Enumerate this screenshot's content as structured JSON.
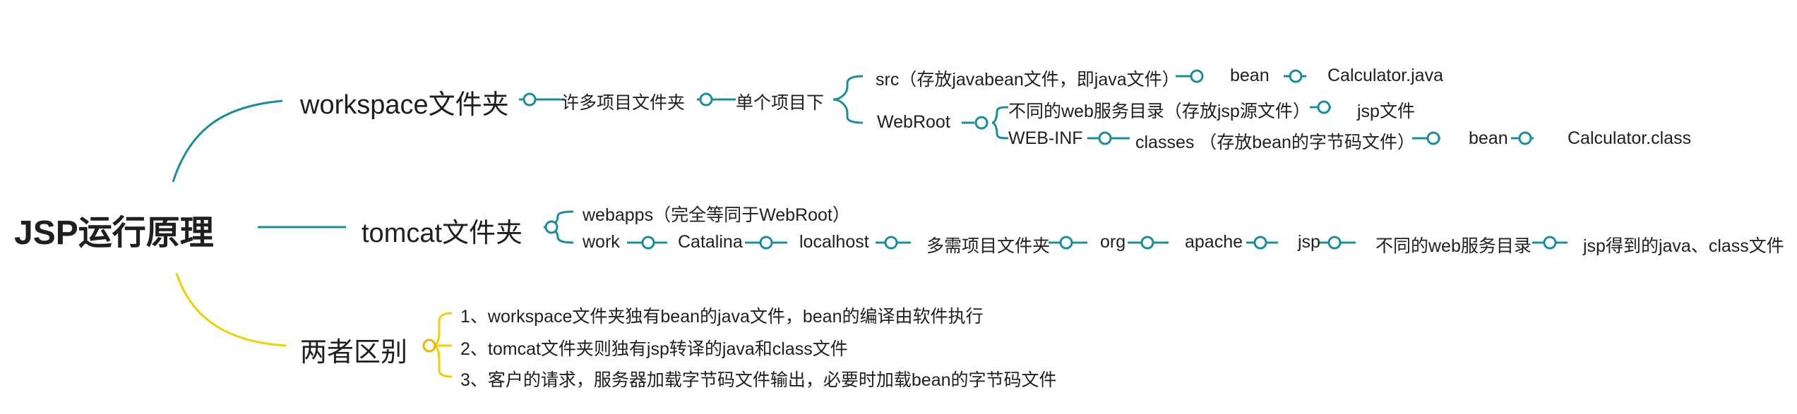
{
  "root": {
    "label": "JSP运行原理"
  },
  "branches": {
    "workspace": {
      "label": "workspace文件夹",
      "l1": "许多项目文件夹",
      "l2": "单个项目下",
      "src": "src（存放javabean文件，即java文件）",
      "src_bean": "bean",
      "src_calc": "Calculator.java",
      "webroot": "WebRoot",
      "webroot_a": "不同的web服务目录（存放jsp源文件）",
      "webroot_a_child": "jsp文件",
      "webroot_b": "WEB-INF",
      "webroot_b_classes": "classes  （存放bean的字节码文件）",
      "webroot_b_bean": "bean",
      "webroot_b_calc": "Calculator.class"
    },
    "tomcat": {
      "label": "tomcat文件夹",
      "webapps": "webapps（完全等同于WebRoot）",
      "work": "work",
      "catalina": "Catalina",
      "localhost": "localhost",
      "multi": "多需项目文件夹",
      "org": "org",
      "apache": "apache",
      "jsp": "jsp",
      "dirs": "不同的web服务目录",
      "result": "jsp得到的java、class文件"
    },
    "diff": {
      "label": "两者区别",
      "items": [
        "1、workspace文件夹独有bean的java文件，bean的编译由软件执行",
        "2、tomcat文件夹则独有jsp转译的java和class文件",
        "3、客户的请求，服务器加载字节码文件输出，必要时加载bean的字节码文件"
      ]
    }
  },
  "colors": {
    "workspace": "#1a8d9c",
    "tomcat": "#1a8d9c",
    "diff": "#f0d000",
    "text": "#1f1f1f"
  }
}
